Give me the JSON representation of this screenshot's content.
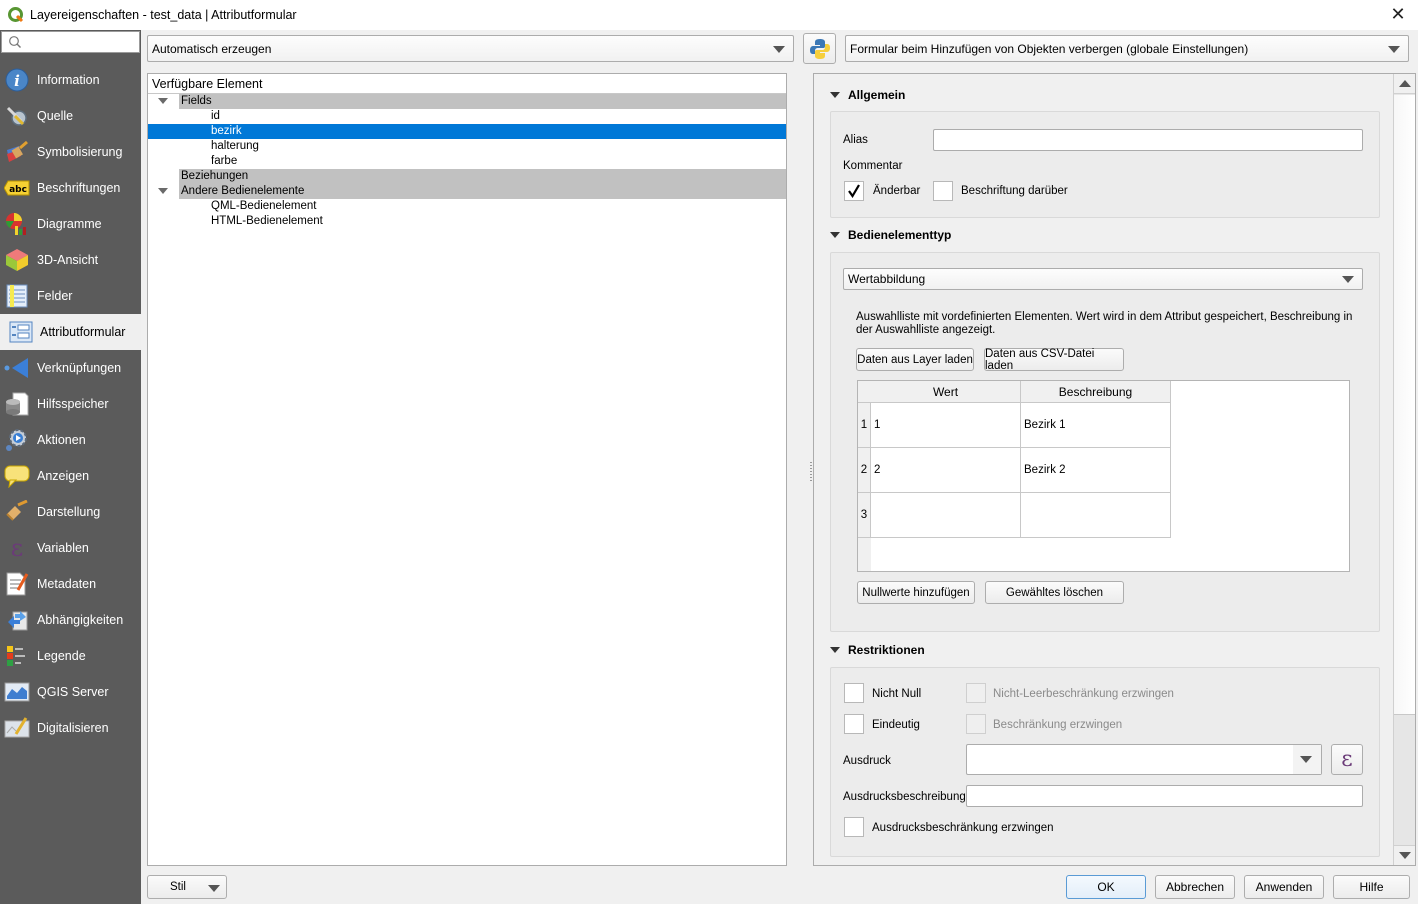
{
  "window": {
    "title": "Layereigenschaften - test_data | Attributformular",
    "close_icon": "close-icon"
  },
  "sidebar": {
    "search_placeholder": "",
    "items": [
      {
        "label": "Information",
        "icon": "info-icon"
      },
      {
        "label": "Quelle",
        "icon": "source-wrench-icon"
      },
      {
        "label": "Symbolisierung",
        "icon": "symbology-brush-icon"
      },
      {
        "label": "Beschriftungen",
        "icon": "labels-abc-icon"
      },
      {
        "label": "Diagramme",
        "icon": "diagram-icon"
      },
      {
        "label": "3D-Ansicht",
        "icon": "3d-cube-icon"
      },
      {
        "label": "Felder",
        "icon": "fields-icon"
      },
      {
        "label": "Attributformular",
        "icon": "attribute-form-icon",
        "active": true
      },
      {
        "label": "Verknüpfungen",
        "icon": "joins-icon"
      },
      {
        "label": "Hilfsspeicher",
        "icon": "auxiliary-storage-icon"
      },
      {
        "label": "Aktionen",
        "icon": "actions-gear-icon"
      },
      {
        "label": "Anzeigen",
        "icon": "display-speech-bubble-icon"
      },
      {
        "label": "Darstellung",
        "icon": "rendering-brush-icon"
      },
      {
        "label": "Variablen",
        "icon": "variables-epsilon-icon"
      },
      {
        "label": "Metadaten",
        "icon": "metadata-icon"
      },
      {
        "label": "Abhängigkeiten",
        "icon": "dependencies-icon"
      },
      {
        "label": "Legende",
        "icon": "legend-icon"
      },
      {
        "label": "QGIS Server",
        "icon": "qgis-server-icon"
      },
      {
        "label": "Digitalisieren",
        "icon": "digitizing-icon"
      }
    ]
  },
  "toolbar": {
    "layout_mode": "Automatisch erzeugen",
    "python_icon": "python-icon",
    "suppress_form": "Formular beim Hinzufügen von Objekten verbergen (globale Einstellungen)"
  },
  "tree": {
    "header": "Verfügbare Element",
    "groups": [
      {
        "label": "Fields",
        "expanded": true,
        "children": [
          "id",
          "bezirk",
          "halterung",
          "farbe"
        ],
        "selected_child": "bezirk"
      },
      {
        "label": "Beziehungen",
        "expanded": false,
        "children": []
      },
      {
        "label": "Andere Bedienelemente",
        "expanded": true,
        "children": [
          "QML-Bedienelement",
          "HTML-Bedienelement"
        ]
      }
    ]
  },
  "general": {
    "title": "Allgemein",
    "alias_label": "Alias",
    "alias_value": "",
    "comment_label": "Kommentar",
    "editable_label": "Änderbar",
    "editable_checked": true,
    "label_on_top_label": "Beschriftung darüber",
    "label_on_top_checked": false
  },
  "widget_type": {
    "title": "Bedienelementtyp",
    "selected": "Wertabbildung",
    "description": "Auswahlliste mit vordefinierten Elementen. Wert wird in dem Attribut gespeichert, Beschreibung in der Auswahlliste angezeigt.",
    "load_from_layer": "Daten aus Layer laden",
    "load_from_csv": "Daten aus CSV-Datei laden",
    "table": {
      "columns": [
        "Wert",
        "Beschreibung"
      ],
      "rows": [
        {
          "index": "1",
          "value": "1",
          "description": "Bezirk 1"
        },
        {
          "index": "2",
          "value": "2",
          "description": "Bezirk 2"
        },
        {
          "index": "3",
          "value": "",
          "description": ""
        }
      ]
    },
    "add_null": "Nullwerte hinzufügen",
    "remove_selected": "Gewähltes löschen"
  },
  "constraints": {
    "title": "Restriktionen",
    "not_null": "Nicht Null",
    "enforce_not_null": "Nicht-Leerbeschränkung erzwingen",
    "unique": "Eindeutig",
    "enforce_unique": "Beschränkung erzwingen",
    "expression_label": "Ausdruck",
    "expression_value": "",
    "expression_desc_label": "Ausdrucksbeschreibung",
    "expression_desc_value": "",
    "enforce_expression": "Ausdrucksbeschränkung erzwingen",
    "epsilon_icon": "expression-epsilon-icon"
  },
  "footer": {
    "style": "Stil",
    "ok": "OK",
    "cancel": "Abbrechen",
    "apply": "Anwenden",
    "help": "Hilfe"
  }
}
